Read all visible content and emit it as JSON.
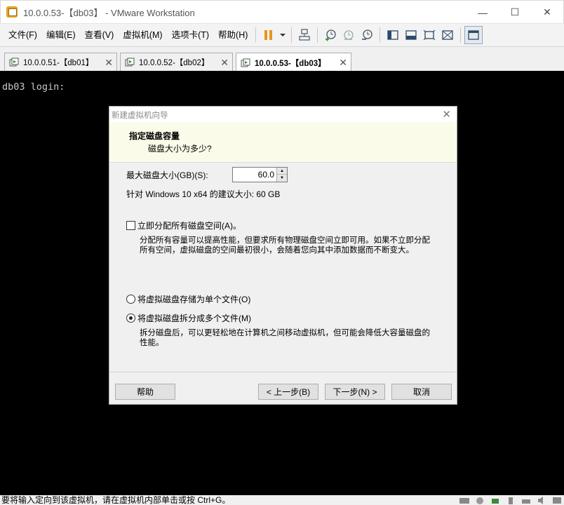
{
  "window": {
    "title": "10.0.0.53-【db03】 - VMware Workstation",
    "minimize": "—",
    "maximize": "☐",
    "close": "✕"
  },
  "menu": [
    "文件(F)",
    "编辑(E)",
    "查看(V)",
    "虚拟机(M)",
    "选项卡(T)",
    "帮助(H)"
  ],
  "tabs": [
    {
      "label": "10.0.0.51-【db01】",
      "active": false
    },
    {
      "label": "10.0.0.52-【db02】",
      "active": false
    },
    {
      "label": "10.0.0.53-【db03】",
      "active": true
    }
  ],
  "console": {
    "text": "db03 login:"
  },
  "dialog": {
    "title": "新建虚拟机向导",
    "heading": "指定磁盘容量",
    "subheading": "磁盘大小为多少?",
    "max_size_label": "最大磁盘大小(GB)(S):",
    "max_size_value": "60.0",
    "recommendation": "针对 Windows 10 x64 的建议大小: 60 GB",
    "allocate_label": "立即分配所有磁盘空间(A)。",
    "allocate_checked": false,
    "allocate_desc_1": "分配所有容量可以提高性能，但要求所有物理磁盘空间立即可用。如果不立即分配",
    "allocate_desc_2": "所有空间，虚拟磁盘的空间最初很小，会随着您向其中添加数据而不断变大。",
    "single_file_label": "将虚拟磁盘存储为单个文件(O)",
    "multi_file_label": "将虚拟磁盘拆分成多个文件(M)",
    "selected_option": "multi",
    "multi_desc_1": "拆分磁盘后，可以更轻松地在计算机之间移动虚拟机，但可能会降低大容量磁盘的",
    "multi_desc_2": "性能。",
    "buttons": {
      "help": "帮助",
      "back": "< 上一步(B)",
      "next": "下一步(N) >",
      "cancel": "取消"
    }
  },
  "status": {
    "text": "要将输入定向到该虚拟机，请在虚拟机内部单击或按 Ctrl+G。"
  }
}
